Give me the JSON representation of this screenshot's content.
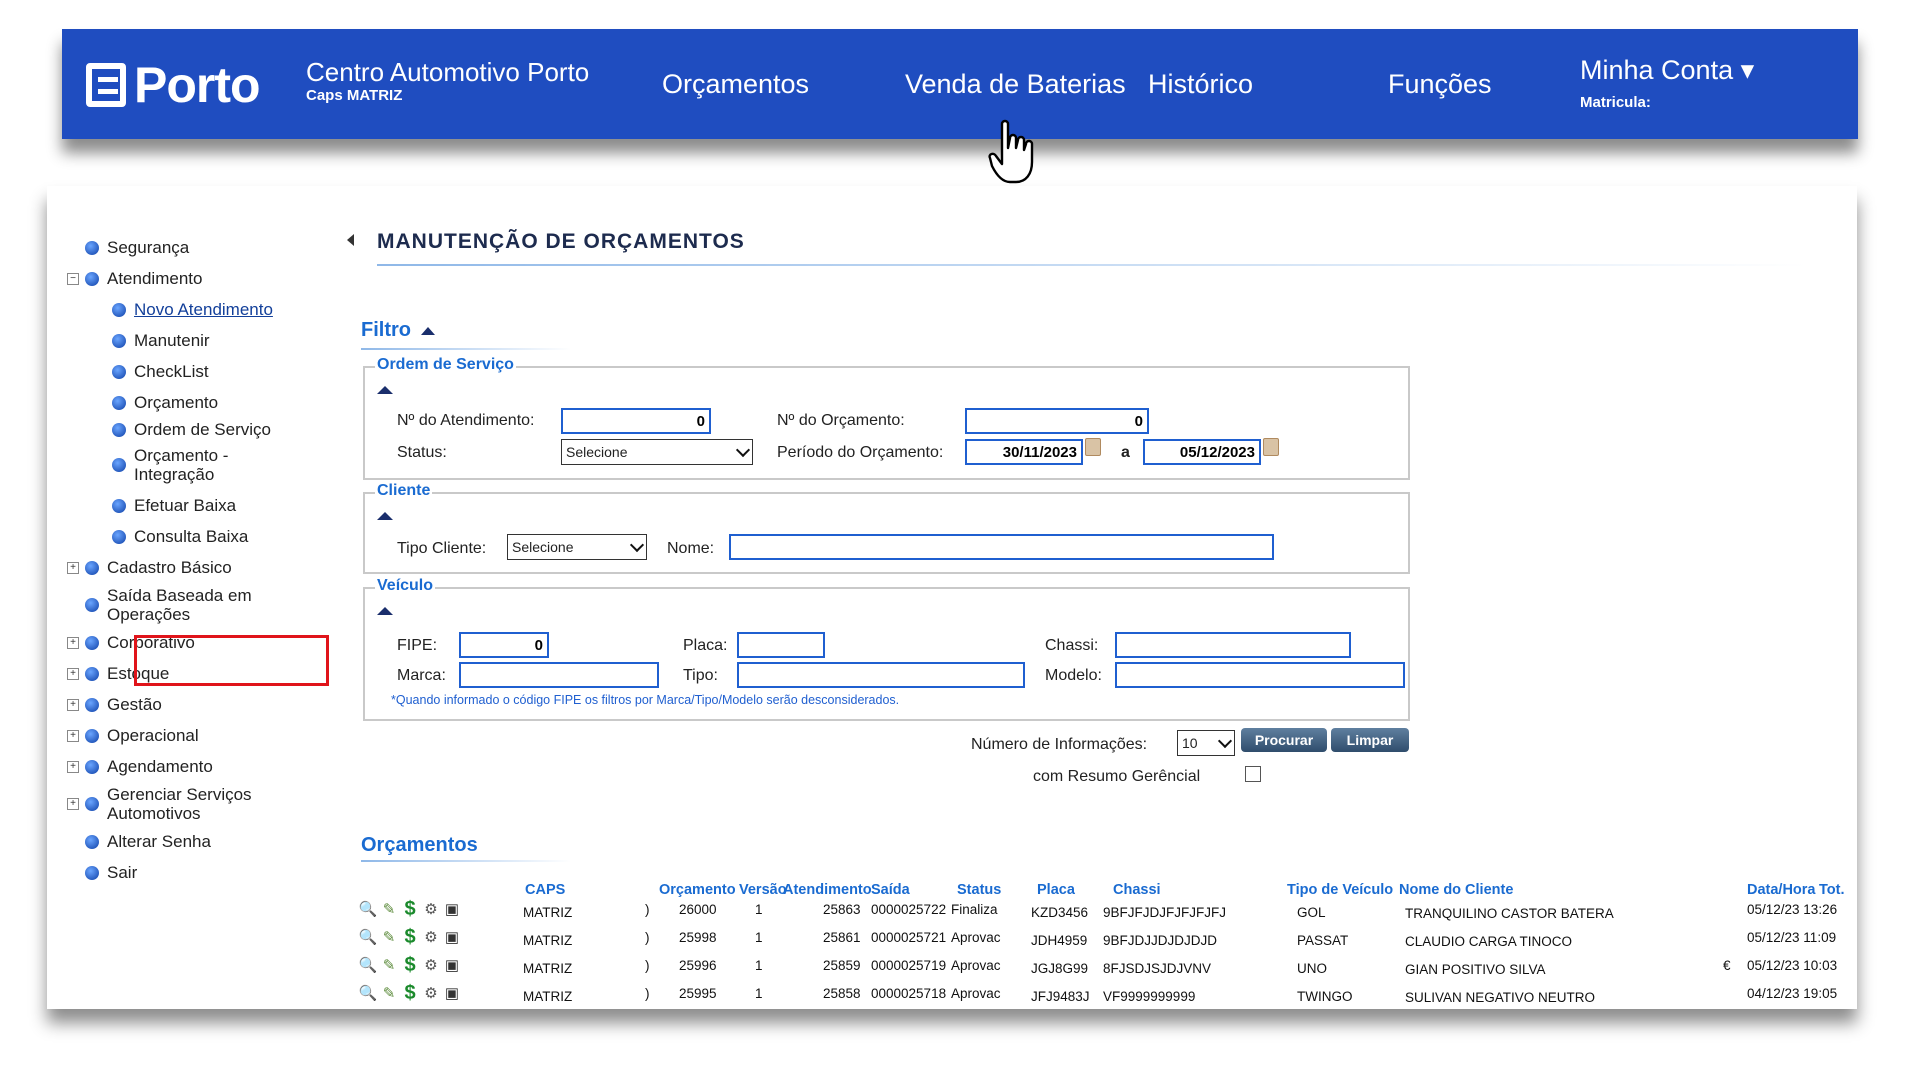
{
  "header": {
    "logo": "Porto",
    "brand_title": "Centro Automotivo Porto",
    "brand_sub": "Caps MATRIZ",
    "nav": [
      "Orçamentos",
      "Venda de Baterias",
      "Histórico",
      "Funções"
    ],
    "account_title": "Minha Conta ▾",
    "account_sub": "Matricula:"
  },
  "sidebar": {
    "items": [
      {
        "label": "Segurança"
      },
      {
        "label": "Atendimento"
      },
      {
        "label": "Novo Atendimento"
      },
      {
        "label": "Manutenir"
      },
      {
        "label": "CheckList"
      },
      {
        "label": "Orçamento"
      },
      {
        "label": "Ordem de Serviço"
      },
      {
        "label": "Orçamento - Integração"
      },
      {
        "label": "Efetuar Baixa"
      },
      {
        "label": "Consulta Baixa"
      },
      {
        "label": "Cadastro Básico"
      },
      {
        "label": "Saída Baseada em Operações"
      },
      {
        "label": "Corporativo"
      },
      {
        "label": "Estoque"
      },
      {
        "label": "Gestão"
      },
      {
        "label": "Operacional"
      },
      {
        "label": "Agendamento"
      },
      {
        "label": "Gerenciar Serviços Automotivos"
      },
      {
        "label": "Alterar Senha"
      },
      {
        "label": "Sair"
      }
    ]
  },
  "page": {
    "title": "MANUTENÇÃO DE ORÇAMENTOS",
    "filter_title": "Filtro",
    "results_title": "Orçamentos"
  },
  "filter": {
    "os_legend": "Ordem de Serviço",
    "atendimento_label": "Nº do Atendimento:",
    "atendimento_value": "0",
    "orcamento_label": "Nº do Orçamento:",
    "orcamento_value": "0",
    "status_label": "Status:",
    "status_value": "Selecione",
    "periodo_label": "Período do Orçamento:",
    "periodo_from": "30/11/2023",
    "periodo_sep": "a",
    "periodo_to": "05/12/2023",
    "cliente_legend": "Cliente",
    "tipo_cliente_label": "Tipo Cliente:",
    "tipo_cliente_value": "Selecione",
    "nome_label": "Nome:",
    "nome_value": "",
    "veiculo_legend": "Veículo",
    "fipe_label": "FIPE:",
    "fipe_value": "0",
    "placa_label": "Placa:",
    "chassi_label": "Chassi:",
    "marca_label": "Marca:",
    "tipo_label": "Tipo:",
    "modelo_label": "Modelo:",
    "note": "*Quando informado o código FIPE os filtros por Marca/Tipo/Modelo serão desconsiderados.",
    "num_info_label": "Número de Informações:",
    "num_info_value": "10",
    "procurar": "Procurar",
    "limpar": "Limpar",
    "resumo_label": "com Resumo Gerêncial"
  },
  "table": {
    "headers": [
      "CAPS",
      "Orçamento",
      "Versão",
      "Atendimento",
      "Saída",
      "Status",
      "Placa",
      "Chassi",
      "Tipo de Veículo",
      "Nome do Cliente",
      "Data/Hora",
      "Tot."
    ],
    "rows": [
      {
        "caps": "MATRIZ",
        "mark": ")",
        "orcamento": "26000",
        "versao": "1",
        "atendimento": "25863",
        "saida": "0000025722",
        "status": "Finaliza",
        "placa": "KZD3456",
        "chassi": "9BFJFJDJFJFJFJFJ",
        "tipo": "GOL",
        "cliente": "TRANQUILINO  CASTOR BATERA",
        "extra": "",
        "data": "05/12/23 13:26"
      },
      {
        "caps": "MATRIZ",
        "mark": ")",
        "orcamento": "25998",
        "versao": "1",
        "atendimento": "25861",
        "saida": "0000025721",
        "status": "Aprovac",
        "placa": "JDH4959",
        "chassi": "9BFJDJJDJDJDJD",
        "tipo": "PASSAT",
        "cliente": "CLAUDIO  CARGA TINOCO",
        "extra": "",
        "data": "05/12/23 11:09"
      },
      {
        "caps": "MATRIZ",
        "mark": ")",
        "orcamento": "25996",
        "versao": "1",
        "atendimento": "25859",
        "saida": "0000025719",
        "status": "Aprovac",
        "placa": "JGJ8G99",
        "chassi": "8FJSDJSJDJVNV",
        "tipo": "UNO",
        "cliente": "GIAN  POSITIVO SILVA",
        "extra": "€",
        "data": "05/12/23 10:03"
      },
      {
        "caps": "MATRIZ",
        "mark": ")",
        "orcamento": "25995",
        "versao": "1",
        "atendimento": "25858",
        "saida": "0000025718",
        "status": "Aprovac",
        "placa": "JFJ9483J",
        "chassi": "VF9999999999",
        "tipo": "TWINGO",
        "cliente": "SULIVAN NEGATIVO NEUTRO",
        "extra": "",
        "data": "04/12/23 19:05"
      }
    ]
  },
  "colors": {
    "brand": "#1f4dc0",
    "accent": "#1a6bd1",
    "highlight": "#e0141a"
  }
}
